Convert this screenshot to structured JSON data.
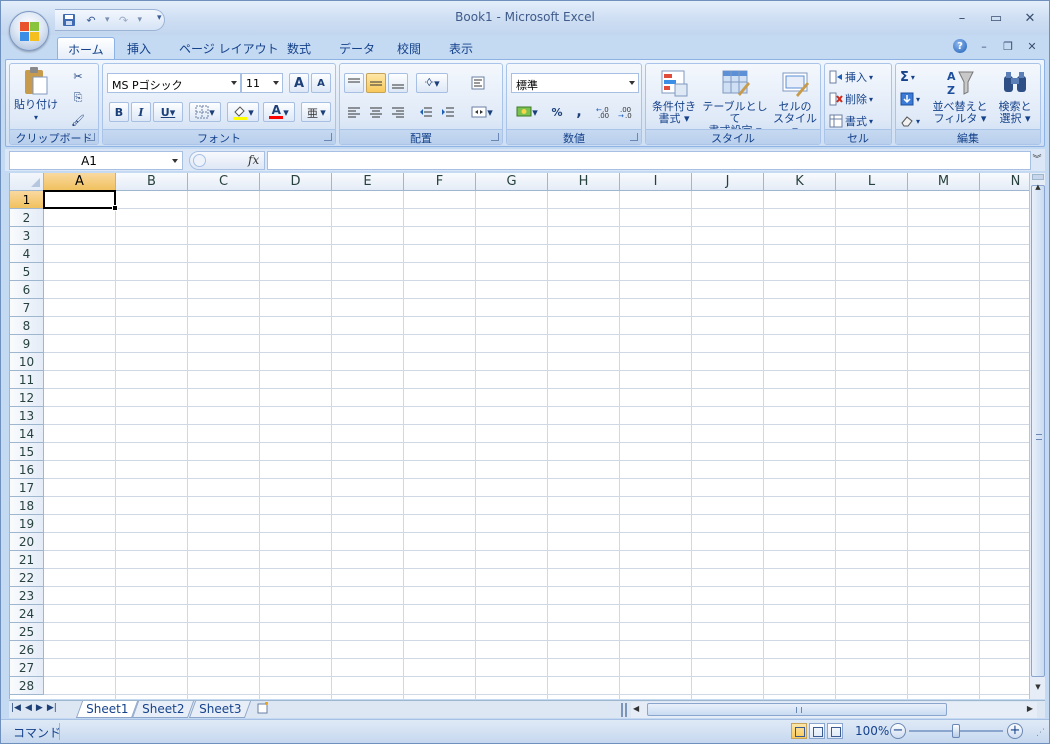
{
  "window": {
    "title": "Book1 - Microsoft Excel"
  },
  "qat": {
    "save": "save",
    "undo": "undo",
    "redo": "redo"
  },
  "tabs": [
    {
      "label": "ホーム",
      "active": true
    },
    {
      "label": "挿入"
    },
    {
      "label": "ページ レイアウト"
    },
    {
      "label": "数式"
    },
    {
      "label": "データ"
    },
    {
      "label": "校閲"
    },
    {
      "label": "表示"
    }
  ],
  "ribbon": {
    "clipboard": {
      "label": "クリップボード",
      "paste": "貼り付け"
    },
    "font": {
      "label": "フォント",
      "font_name": "MS Pゴシック",
      "font_size": "11",
      "bold": "B",
      "italic": "I",
      "underline": "U",
      "grow": "A",
      "shrink": "A",
      "font_color": "A"
    },
    "alignment": {
      "label": "配置"
    },
    "number": {
      "label": "数値",
      "format": "標準",
      "percent": "%",
      "comma": ","
    },
    "styles": {
      "label": "スタイル",
      "conditional_1": "条件付き",
      "conditional_2": "書式",
      "table_1": "テーブルとして",
      "table_2": "書式設定",
      "cell_1": "セルの",
      "cell_2": "スタイル"
    },
    "cells": {
      "label": "セル",
      "insert": "挿入",
      "delete": "削除",
      "format": "書式"
    },
    "editing": {
      "label": "編集",
      "sort_1": "並べ替えと",
      "sort_2": "フィルタ",
      "find_1": "検索と",
      "find_2": "選択",
      "sum": "Σ"
    }
  },
  "formula_bar": {
    "name_box": "A1",
    "fx": "fx",
    "formula": ""
  },
  "grid": {
    "columns": [
      "A",
      "B",
      "C",
      "D",
      "E",
      "F",
      "G",
      "H",
      "I",
      "J",
      "K",
      "L",
      "M",
      "N"
    ],
    "rows": [
      "1",
      "2",
      "3",
      "4",
      "5",
      "6",
      "7",
      "8",
      "9",
      "10",
      "11",
      "12",
      "13",
      "14",
      "15",
      "16",
      "17",
      "18",
      "19",
      "20",
      "21",
      "22",
      "23",
      "24",
      "25",
      "26",
      "27",
      "28"
    ],
    "selected_col": "A",
    "selected_row": "1"
  },
  "sheets": [
    {
      "label": "Sheet1",
      "active": true
    },
    {
      "label": "Sheet2"
    },
    {
      "label": "Sheet3"
    }
  ],
  "status": {
    "mode": "コマンド",
    "zoom": "100%",
    "zoom_level": 100
  }
}
